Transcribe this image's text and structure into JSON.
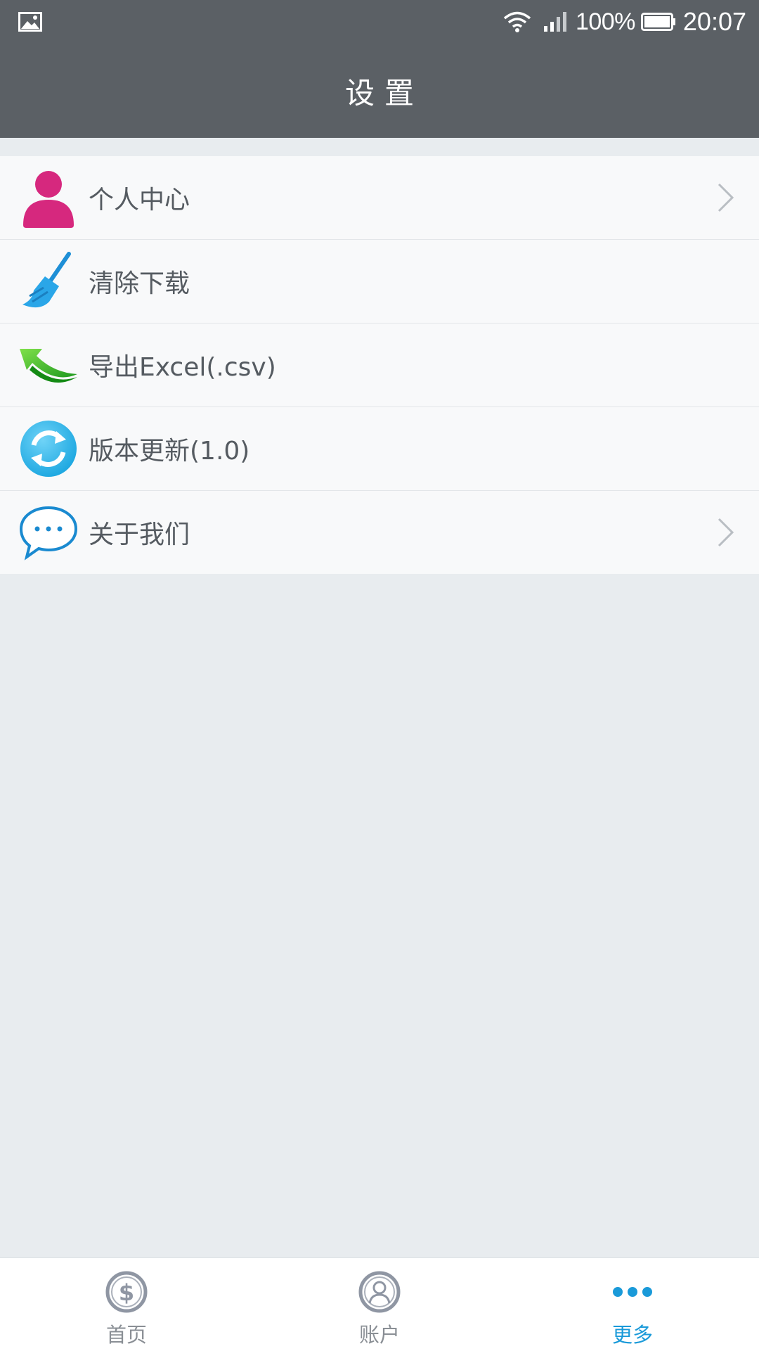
{
  "status_bar": {
    "battery_percent": "100%",
    "time": "20:07"
  },
  "header": {
    "title": "设置"
  },
  "settings": {
    "items": [
      {
        "label": "个人中心",
        "icon": "person-icon",
        "has_arrow": true
      },
      {
        "label": "清除下载",
        "icon": "broom-icon",
        "has_arrow": false
      },
      {
        "label": "导出Excel(.csv)",
        "icon": "export-arrow-icon",
        "has_arrow": false
      },
      {
        "label": "版本更新(1.0)",
        "icon": "refresh-icon",
        "has_arrow": false
      },
      {
        "label": "关于我们",
        "icon": "chat-bubble-icon",
        "has_arrow": true
      }
    ]
  },
  "bottom_nav": {
    "tabs": [
      {
        "label": "首页",
        "icon": "dollar-coin-icon",
        "active": false
      },
      {
        "label": "账户",
        "icon": "account-user-icon",
        "active": false
      },
      {
        "label": "更多",
        "icon": "more-dots-icon",
        "active": true
      }
    ]
  },
  "colors": {
    "header_bg": "#5b6065",
    "page_bg": "#e8ecef",
    "list_bg": "#f8f9fa",
    "accent": "#1a9ad9",
    "nav_inactive": "#8a8f95",
    "person_icon": "#d6287e"
  }
}
